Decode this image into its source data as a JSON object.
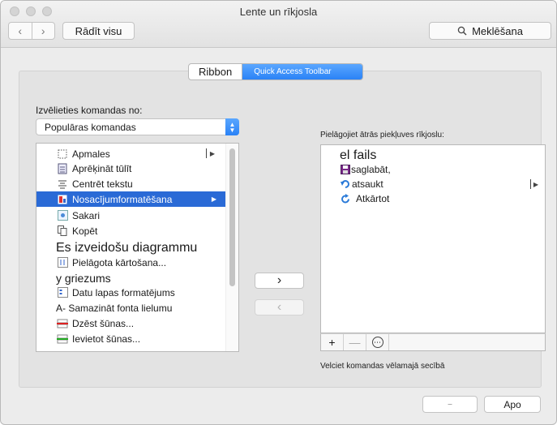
{
  "window": {
    "title": "Lente un rīkjosla"
  },
  "toolbar": {
    "back_icon": "‹",
    "forward_icon": "›",
    "show_all_label": "Rādīt visu",
    "search_label": "Meklēšana"
  },
  "tabs": [
    {
      "label": "Ribbon",
      "active": false
    },
    {
      "label": "Quick Access Toolbar",
      "active": true
    }
  ],
  "commands": {
    "choose_label": "Izvēlieties komandas no:",
    "source_selected": "Populāras komandas",
    "items": [
      {
        "label": "Apmales",
        "icon": "borders-icon",
        "submenu": true
      },
      {
        "label": "Aprēķināt tūlīt",
        "icon": "calculator-icon"
      },
      {
        "label": "Centrēt tekstu",
        "icon": "align-center-icon"
      },
      {
        "label": "Nosacījumformatēšana",
        "icon": "conditional-format-icon",
        "submenu": true,
        "selected": true
      },
      {
        "label": "Sakari",
        "icon": "connections-icon"
      },
      {
        "label": "Kopēt",
        "icon": "copy-icon"
      },
      {
        "label": "Es izveidošu diagrammu",
        "icon": ""
      },
      {
        "label": "Pielāgota kārtošana...",
        "icon": "sort-icon"
      },
      {
        "label": "y griezums",
        "icon": ""
      },
      {
        "label": "Datu lapas formatējums",
        "icon": "format-icon"
      },
      {
        "label": "A- Samazināt fonta lielumu",
        "icon": ""
      },
      {
        "label": "Dzēst šūnas...",
        "icon": "delete-cells-icon"
      },
      {
        "label": "Ievietot šūnas...",
        "icon": "insert-cells-icon"
      }
    ]
  },
  "transfer": {
    "add_icon": "›",
    "remove_icon": "‹"
  },
  "qat": {
    "customize_label": "Pielāgojiet ātrās piekļuves rīkjoslu:",
    "items": [
      {
        "label": "el fails",
        "icon": ""
      },
      {
        "label": "saglabāt,",
        "icon": "save-icon"
      },
      {
        "label": "atsaukt",
        "icon": "undo-icon"
      },
      {
        "label": "Atkārtot",
        "icon": "redo-icon"
      }
    ],
    "footer_add": "+",
    "footer_remove": "—",
    "footer_more": "⋯",
    "reorder_hint": "Velciet komandas vēlamajā secībā"
  },
  "footer": {
    "small_button": "—",
    "ok_label": "Apo"
  },
  "colors": {
    "accent": "#2a82f6",
    "selection": "#2a6ad6"
  }
}
